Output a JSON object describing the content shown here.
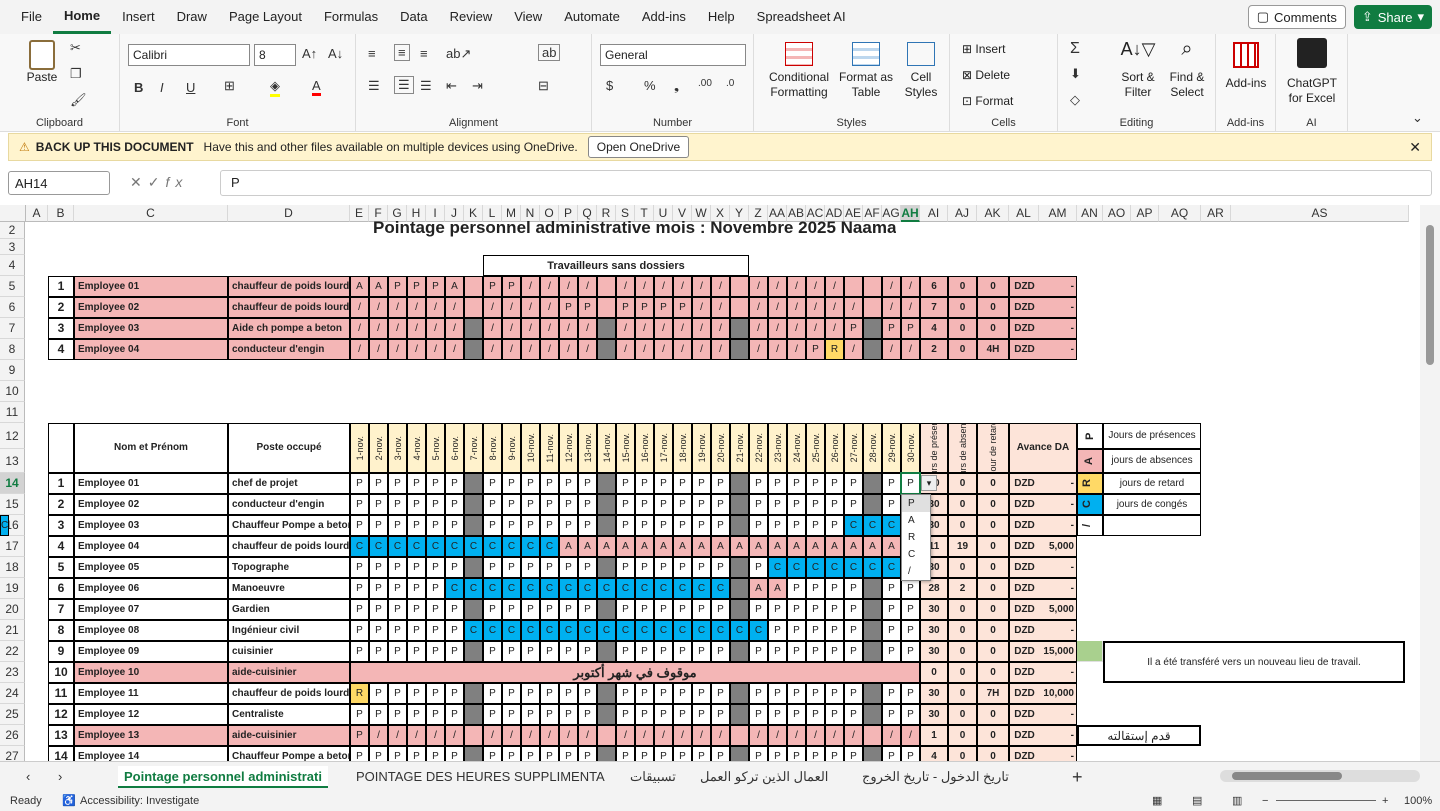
{
  "menu": [
    "File",
    "Home",
    "Insert",
    "Draw",
    "Page Layout",
    "Formulas",
    "Data",
    "Review",
    "View",
    "Automate",
    "Add-ins",
    "Help",
    "Spreadsheet AI"
  ],
  "active_menu": "Home",
  "top_buttons": {
    "comments": "Comments",
    "share": "Share"
  },
  "ribbon": {
    "clipboard": {
      "label": "Clipboard",
      "paste": "Paste"
    },
    "font": {
      "label": "Font",
      "name": "Calibri",
      "size": "8"
    },
    "alignment": {
      "label": "Alignment"
    },
    "number": {
      "label": "Number",
      "format": "General"
    },
    "styles": {
      "label": "Styles",
      "conditional": "Conditional",
      "formatting": "Formatting",
      "format_as": "Format as",
      "table": "Table",
      "cell": "Cell",
      "styles_btn": "Styles"
    },
    "cells": {
      "label": "Cells",
      "insert": "Insert",
      "delete": "Delete",
      "format": "Format"
    },
    "editing": {
      "label": "Editing",
      "sort": "Sort &",
      "filter": "Filter",
      "find": "Find &",
      "select": "Select"
    },
    "addins": {
      "label": "Add-ins",
      "btn": "Add-ins"
    },
    "ai": {
      "label": "AI",
      "chatgpt": "ChatGPT",
      "for_excel": "for Excel"
    }
  },
  "notification": {
    "title": "BACK UP THIS DOCUMENT",
    "text": "Have this and other files available on multiple devices using OneDrive.",
    "button": "Open OneDrive"
  },
  "formula_bar": {
    "namebox": "AH14",
    "value": "P"
  },
  "columns": [
    "A",
    "B",
    "C",
    "D",
    "E",
    "F",
    "G",
    "H",
    "I",
    "J",
    "K",
    "L",
    "M",
    "N",
    "O",
    "P",
    "Q",
    "R",
    "S",
    "T",
    "U",
    "V",
    "W",
    "X",
    "Y",
    "Z",
    "AA",
    "AB",
    "AC",
    "AD",
    "AE",
    "AF",
    "AG",
    "AH",
    "AI",
    "AJ",
    "AK",
    "AL",
    "AM",
    "AN",
    "AO",
    "AP",
    "AQ",
    "AR",
    "AS"
  ],
  "rows": [
    "2",
    "3",
    "4",
    "5",
    "6",
    "7",
    "8",
    "9",
    "10",
    "11",
    "12",
    "13",
    "14",
    "15",
    "16",
    "17",
    "18",
    "19",
    "20",
    "21",
    "22",
    "23",
    "24",
    "25",
    "26",
    "27"
  ],
  "sheet": {
    "title": "Pointage personnel administrative mois : Novembre 2025  Naama",
    "top_header": "Travailleurs sans dossiers",
    "top_rows": [
      {
        "n": "1",
        "name": "Employee 01",
        "job": "chauffeur de poids lourds",
        "days": "A A P P P A _ P P / / / / _ / / / / / / _ / / / / / _ _ / /",
        "p": "6",
        "a": "0",
        "r": "0",
        "cur": "DZD",
        "adv": "-"
      },
      {
        "n": "2",
        "name": "Employee 02",
        "job": "chauffeur de poids lourds",
        "days": "/ / / / / / _ / / / / P P _ P P P P / / _ / / / / / / _ / /",
        "p": "7",
        "a": "0",
        "r": "0",
        "cur": "DZD",
        "adv": "-"
      },
      {
        "n": "3",
        "name": "Employee 03",
        "job": "Aide ch pompe a beton",
        "days": "/ / / / / / # / / / / / / # / / / / / / # / / / / / P # P P",
        "p": "4",
        "a": "0",
        "r": "0",
        "cur": "DZD",
        "adv": "-"
      },
      {
        "n": "4",
        "name": "Employee 04",
        "job": "conducteur d'engin",
        "days": "/ / / / / / # / / / / / / # / / / / / / # / / / P R / # / /",
        "p": "2",
        "a": "0",
        "r": "4H",
        "cur": "DZD",
        "adv": "-"
      }
    ],
    "headers": {
      "name": "Nom et Prénom",
      "job": "Poste occupé",
      "presence": "Jours de présence",
      "absence": "jours de absence",
      "retard": "hour de retard",
      "avance": "Avance DA"
    },
    "days": [
      "1-nov.",
      "2-nov.",
      "3-nov.",
      "4-nov.",
      "5-nov.",
      "6-nov.",
      "7-nov.",
      "8-nov.",
      "9-nov.",
      "10-nov.",
      "11-nov.",
      "12-nov.",
      "13-nov.",
      "14-nov.",
      "15-nov.",
      "16-nov.",
      "17-nov.",
      "18-nov.",
      "19-nov.",
      "20-nov.",
      "21-nov.",
      "22-nov.",
      "23-nov.",
      "24-nov.",
      "25-nov.",
      "26-nov.",
      "27-nov.",
      "28-nov.",
      "29-nov.",
      "30-nov."
    ],
    "legend": [
      {
        "code": "P",
        "text": "Jours de présences",
        "color": "#ffffff"
      },
      {
        "code": "A",
        "text": "jours de absences",
        "color": "#f4b6b6"
      },
      {
        "code": "R",
        "text": "jours de retard",
        "color": "#ffd966"
      },
      {
        "code": "C",
        "text": "jours de congés",
        "color": "#00b0f0"
      },
      {
        "code": "/",
        "text": "",
        "color": "#ffffff"
      }
    ],
    "main_rows": [
      {
        "n": "1",
        "name": "Employee 01",
        "job": "chef de projet",
        "days": "P P P P P P # P P P P P P # P P P P P P # P P P P P P # P P",
        "p": "30",
        "a": "0",
        "r": "0",
        "cur": "DZD",
        "adv": "-"
      },
      {
        "n": "2",
        "name": "Employee 02",
        "job": "conducteur d'engin",
        "days": "P P P P P P # P P P P P P # P P P P P P # P P P P P P # P P",
        "p": "30",
        "a": "0",
        "r": "0",
        "cur": "DZD",
        "adv": "-"
      },
      {
        "n": "3",
        "name": "Employee 03",
        "job": "Chauffeur Pompe a beton",
        "days": "P P P P P P # P P P P P P # P P P P P P # P P P P P C C C C C",
        "p": "30",
        "a": "0",
        "r": "0",
        "cur": "DZD",
        "adv": "-"
      },
      {
        "n": "4",
        "name": "Employee 04",
        "job": "chauffeur de poids lourds",
        "days": "C C C C C C C C C C C A A A A A A A A A A A A A A A A A A A",
        "p": "11",
        "a": "19",
        "r": "0",
        "cur": "DZD",
        "adv": "5,000"
      },
      {
        "n": "5",
        "name": "Employee 05",
        "job": "Topographe",
        "days": "P P P P P P # P P P P P P # P P P P P P # P C C C C C C C C",
        "p": "30",
        "a": "0",
        "r": "0",
        "cur": "DZD",
        "adv": "-"
      },
      {
        "n": "6",
        "name": "Employee 06",
        "job": "Manoeuvre",
        "days": "P P P P P C C C C C C C C C C C C C C C # A A P P P P # P P",
        "p": "28",
        "a": "2",
        "r": "0",
        "cur": "DZD",
        "adv": "-"
      },
      {
        "n": "7",
        "name": "Employee 07",
        "job": "Gardien",
        "days": "P P P P P P # P P P P P P # P P P P P P # P P P P P P # P P",
        "p": "30",
        "a": "0",
        "r": "0",
        "cur": "DZD",
        "adv": "5,000"
      },
      {
        "n": "8",
        "name": "Employee 08",
        "job": "Ingénieur civil",
        "days": "P P P P P P C C C C C C C C C C C C C C C C P P P P P # P P",
        "p": "30",
        "a": "0",
        "r": "0",
        "cur": "DZD",
        "adv": "-"
      },
      {
        "n": "9",
        "name": "Employee 09",
        "job": "cuisinier",
        "days": "P P P P P P # P P P P P P # P P P P P P # P P P P P P # P P",
        "p": "30",
        "a": "0",
        "r": "0",
        "cur": "DZD",
        "adv": "15,000"
      },
      {
        "n": "10",
        "name": "Employee 10",
        "job": "aide-cuisinier",
        "merged": "موقوف في شهر أكتوبر",
        "p": "0",
        "a": "0",
        "r": "0",
        "cur": "DZD",
        "adv": "-"
      },
      {
        "n": "11",
        "name": "Employee 11",
        "job": "chauffeur de poids lourds",
        "days": "R P P P P P # P P P P P P # P P P P P P # P P P P P P # P P",
        "p": "30",
        "a": "0",
        "r": "7H",
        "cur": "DZD",
        "adv": "10,000"
      },
      {
        "n": "12",
        "name": "Employee 12",
        "job": "Centraliste",
        "days": "P P P P P P # P P P P P P # P P P P P P # P P P P P P # P P",
        "p": "30",
        "a": "0",
        "r": "0",
        "cur": "DZD",
        "adv": "-"
      },
      {
        "n": "13",
        "name": "Employee 13",
        "job": "aide-cuisinier",
        "days": "P / / / / / _ / / / / / / _ / / / / / / _ / / / / / / _ / /",
        "p": "1",
        "a": "0",
        "r": "0",
        "cur": "DZD",
        "adv": "-"
      },
      {
        "n": "14",
        "name": "Employee 14",
        "job": "Chauffeur Pompe a beton",
        "days": "P P P P P P # P P P P P P # P P P P P P # P P P P P P # P P",
        "p": "4",
        "a": "0",
        "r": "0",
        "cur": "DZD",
        "adv": "-"
      }
    ],
    "note_transfer": "Il a été transféré vers un nouveau lieu de travail.",
    "note_resign": "قدم إستقالته",
    "dropdown": [
      "P",
      "A",
      "R",
      "C",
      "/"
    ]
  },
  "tabs": [
    "Pointage personnel administrati",
    "POINTAGE DES HEURES SUPPLIMENTA",
    "تسبيقات",
    "العمال الذين تركو العمل",
    "تاريخ الدخول - تاريخ الخروج"
  ],
  "status": {
    "ready": "Ready",
    "accessibility": "Accessibility: Investigate",
    "zoom": "100%"
  },
  "colors": {
    "accent": "#107c41",
    "pink": "#f4b6b6",
    "blue": "#00b0f0",
    "yellow": "#ffd966",
    "gray": "#808080",
    "peach": "#fde4d9"
  }
}
